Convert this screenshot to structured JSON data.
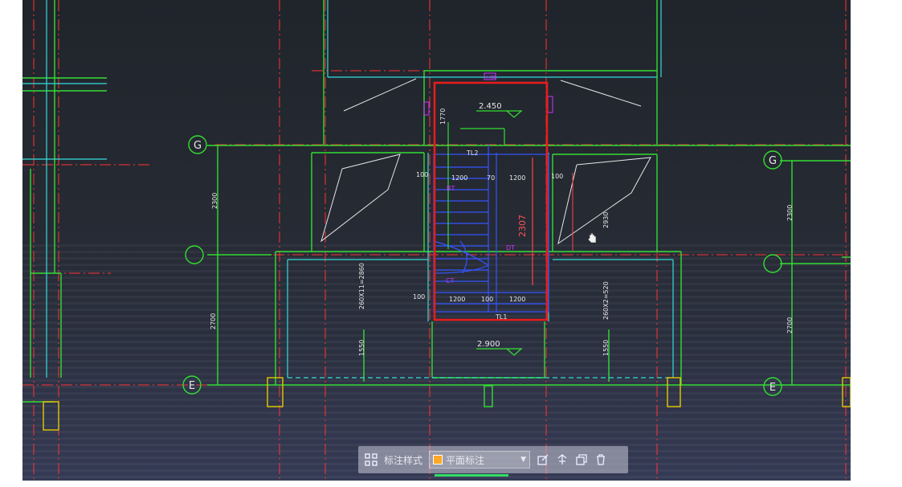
{
  "drawing": {
    "grid_labels": [
      "G",
      "E",
      "G",
      "E"
    ],
    "levels": [
      "2.450",
      "2.900"
    ],
    "stair_labels": [
      "TL2",
      "TL1",
      "BT",
      "CT",
      "DT",
      "2307",
      "HOL"
    ],
    "dimensions": [
      "1770",
      "1200",
      "70",
      "1200",
      "100",
      "100",
      "1200",
      "100",
      "1200",
      "100",
      "2300",
      "2700",
      "260X11=2860",
      "1550",
      "2930",
      "260X2=520",
      "1550",
      "2300",
      "2700"
    ],
    "colors": {
      "grid": "#33dd33",
      "axis": "#ff3333",
      "wall": "#33dddd",
      "stair": "#3355ff",
      "highlight": "#e81c1c",
      "text": "#e6e6e6"
    }
  },
  "toolbar": {
    "apps_icon": "grid-icon",
    "label": "标注样式",
    "select_value": "平面标注",
    "swatch_color": "#ffa726",
    "icons": [
      "edit-icon",
      "split-icon",
      "copy-icon",
      "delete-icon"
    ]
  }
}
